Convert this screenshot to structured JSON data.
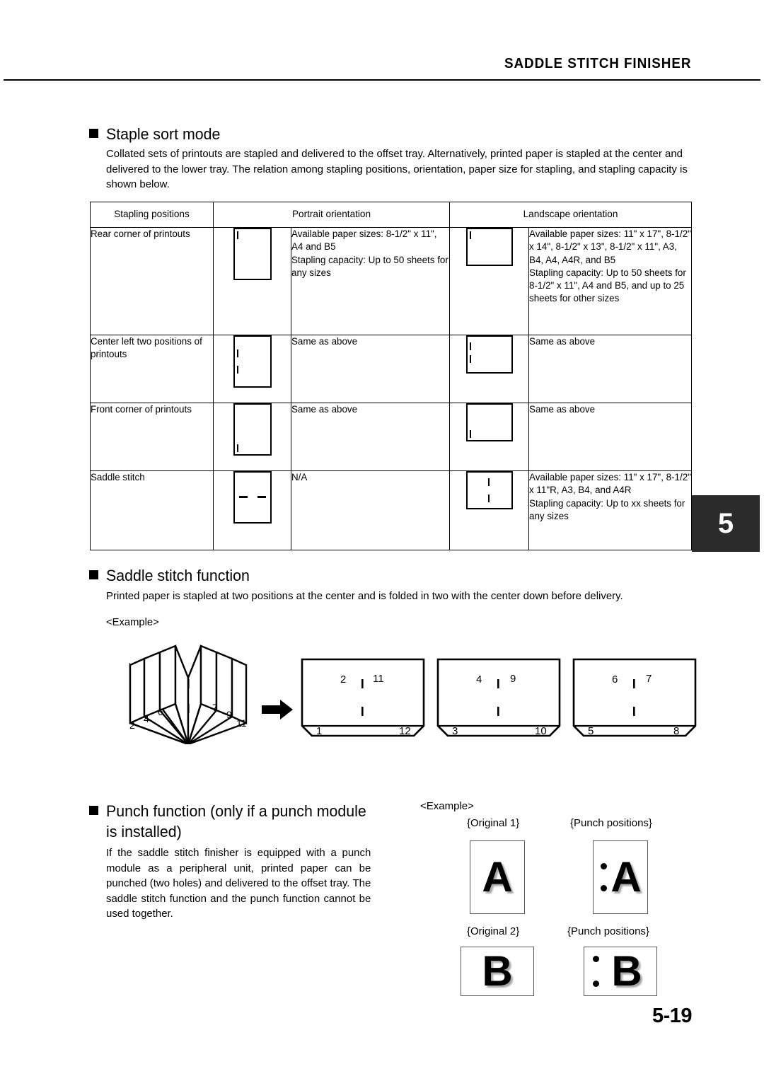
{
  "header": {
    "title": "SADDLE STITCH FINISHER"
  },
  "chapter_tab": "5",
  "page_number": "5-19",
  "staple_sort": {
    "heading": "Staple sort mode",
    "body": "Collated sets of printouts are stapled and delivered to the offset tray. Alternatively, printed paper is stapled at the center and delivered to the lower tray. The relation among stapling positions, orientation, paper size for stapling, and stapling capacity is shown below.",
    "table": {
      "headers": [
        "Stapling positions",
        "Portrait orientation",
        "Landscape orientation"
      ],
      "rows": [
        {
          "position": "Rear corner of printouts",
          "portrait_desc": "Available paper sizes: 8-1/2\" x 11\", A4 and B5\nStapling capacity: Up to 50 sheets for any sizes",
          "landscape_desc": "Available paper sizes: 11\" x 17\", 8-1/2\" x 14\", 8-1/2\" x 13\", 8-1/2\" x 11\", A3, B4, A4, A4R, and B5\nStapling capacity: Up to 50 sheets for 8-1/2\" x 11\", A4 and B5, and up to 25 sheets for other sizes",
          "portrait_icon": "paper-portrait-staple-top-left",
          "landscape_icon": "paper-landscape-staple-top-left"
        },
        {
          "position": "Center left two positions of printouts",
          "portrait_desc": "Same as above",
          "landscape_desc": "Same as above",
          "portrait_icon": "paper-portrait-staple-left-two",
          "landscape_icon": "paper-landscape-staple-left-two"
        },
        {
          "position": "Front corner of printouts",
          "portrait_desc": "Same as above",
          "landscape_desc": "Same as above",
          "portrait_icon": "paper-portrait-staple-bottom-left",
          "landscape_icon": "paper-landscape-staple-bottom-left"
        },
        {
          "position": "Saddle stitch",
          "portrait_desc": "N/A",
          "landscape_desc": "Available paper sizes: 11\" x 17\", 8-1/2\" x 11\"R, A3, B4, and A4R\nStapling capacity: Up to xx sheets for any sizes",
          "portrait_icon": "paper-portrait-saddle-center",
          "landscape_icon": "paper-landscape-saddle-center"
        }
      ]
    }
  },
  "saddle_stitch": {
    "heading": "Saddle stitch function",
    "body": "Printed paper is stapled at two positions at the center and is folded in two with the center down before delivery.",
    "example_label": "<Example>",
    "booklet_page_numbers": [
      "2",
      "4",
      "6",
      "7",
      "9",
      "11"
    ],
    "sheets": [
      {
        "top_left": "2",
        "top_right": "11",
        "bottom_left": "1",
        "bottom_right": "12"
      },
      {
        "top_left": "4",
        "top_right": "9",
        "bottom_left": "3",
        "bottom_right": "10"
      },
      {
        "top_left": "6",
        "top_right": "7",
        "bottom_left": "5",
        "bottom_right": "8"
      }
    ]
  },
  "punch": {
    "heading": "Punch function (only if a punch module\nis installed)",
    "body": "If the saddle stitch finisher is equipped with a punch module as a peripheral unit, printed paper can be punched (two holes) and delivered to the offset tray. The saddle stitch function and the punch function cannot be used together.",
    "example_label": "<Example>",
    "captions": {
      "original_1": "{Original 1}",
      "punch_positions_1": "{Punch positions}",
      "original_2": "{Original 2}",
      "punch_positions_2": "{Punch positions}"
    },
    "glyphs": {
      "a": "A",
      "b": "B"
    }
  },
  "colors": {
    "ink": "#000000",
    "chapter_tab_bg": "#2b2b2b",
    "chapter_tab_fg": "#ffffff"
  }
}
